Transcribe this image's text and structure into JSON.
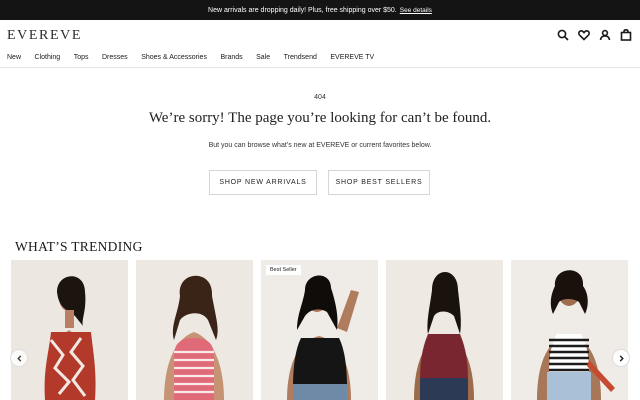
{
  "promo": {
    "text": "New arrivals are dropping daily! Plus, free shipping over $50.",
    "link": "See details"
  },
  "header": {
    "logo": "EVEREVE",
    "icons": [
      "search-icon",
      "heart-icon",
      "account-icon",
      "bag-icon"
    ]
  },
  "nav": {
    "items": [
      "New",
      "Clothing",
      "Tops",
      "Dresses",
      "Shoes & Accessories",
      "Brands",
      "Sale",
      "Trendsend",
      "EVEREVE TV"
    ]
  },
  "error": {
    "code": "404",
    "title": "We’re sorry! The page you’re looking for can’t be found.",
    "subtitle": "But you can browse what’s new at EVEREVE or current favorites below."
  },
  "cta": {
    "new_arrivals": "SHOP NEW ARRIVALS",
    "best_sellers": "SHOP BEST SELLERS"
  },
  "trending": {
    "title": "WHAT’S TRENDING",
    "products": [
      {
        "badge": "",
        "top_color": "#b33a2a",
        "pattern": "geo-print"
      },
      {
        "badge": "",
        "top_color": "#e06a78",
        "pattern": "stripes"
      },
      {
        "badge": "Best Seller",
        "top_color": "#151515",
        "pattern": "solid"
      },
      {
        "badge": "",
        "top_color": "#7a2630",
        "pattern": "solid"
      },
      {
        "badge": "",
        "top_color": "#1c1c1c",
        "pattern": "stripes"
      }
    ]
  },
  "colors": {
    "promo_bg": "#141414",
    "card_bg": "#ece8e3"
  }
}
